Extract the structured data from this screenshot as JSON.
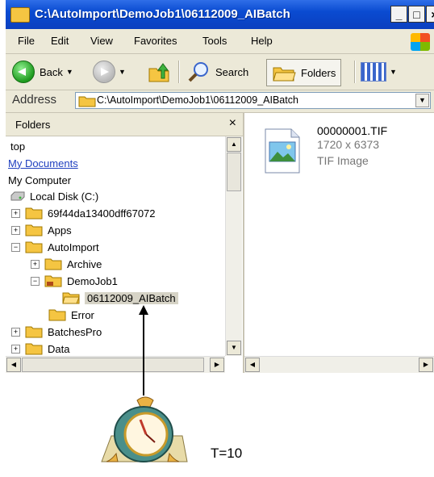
{
  "window": {
    "title": "C:\\AutoImport\\DemoJob1\\06112009_AIBatch",
    "buttons": {
      "minimize": "_",
      "maximize": "□",
      "close": "×"
    }
  },
  "menu": [
    "File",
    "Edit",
    "View",
    "Favorites",
    "Tools",
    "Help"
  ],
  "toolbar": {
    "back": "Back",
    "search": "Search",
    "folders": "Folders"
  },
  "address": {
    "label": "Address",
    "value": "C:\\AutoImport\\DemoJob1\\06112009_AIBatch"
  },
  "folders_pane": {
    "title": "Folders",
    "close": "×",
    "tree": [
      {
        "label": "top"
      },
      {
        "label": "My Documents"
      },
      {
        "label": "My Computer"
      },
      {
        "label": "Local Disk (C:)"
      },
      {
        "label": "69f44da13400dff67072",
        "expander": "+"
      },
      {
        "label": "Apps",
        "expander": "+"
      },
      {
        "label": "AutoImport",
        "expander": "−"
      },
      {
        "label": "Archive",
        "expander": "+"
      },
      {
        "label": "DemoJob1",
        "expander": "−"
      },
      {
        "label": "06112009_AIBatch"
      },
      {
        "label": "Error"
      },
      {
        "label": "BatchesPro",
        "expander": "+"
      },
      {
        "label": "Data",
        "expander": "+"
      }
    ]
  },
  "file": {
    "name": "00000001.TIF",
    "dimensions": "1720 x 6373",
    "type": "TIF Image"
  },
  "annotation": {
    "label": "T=10"
  }
}
